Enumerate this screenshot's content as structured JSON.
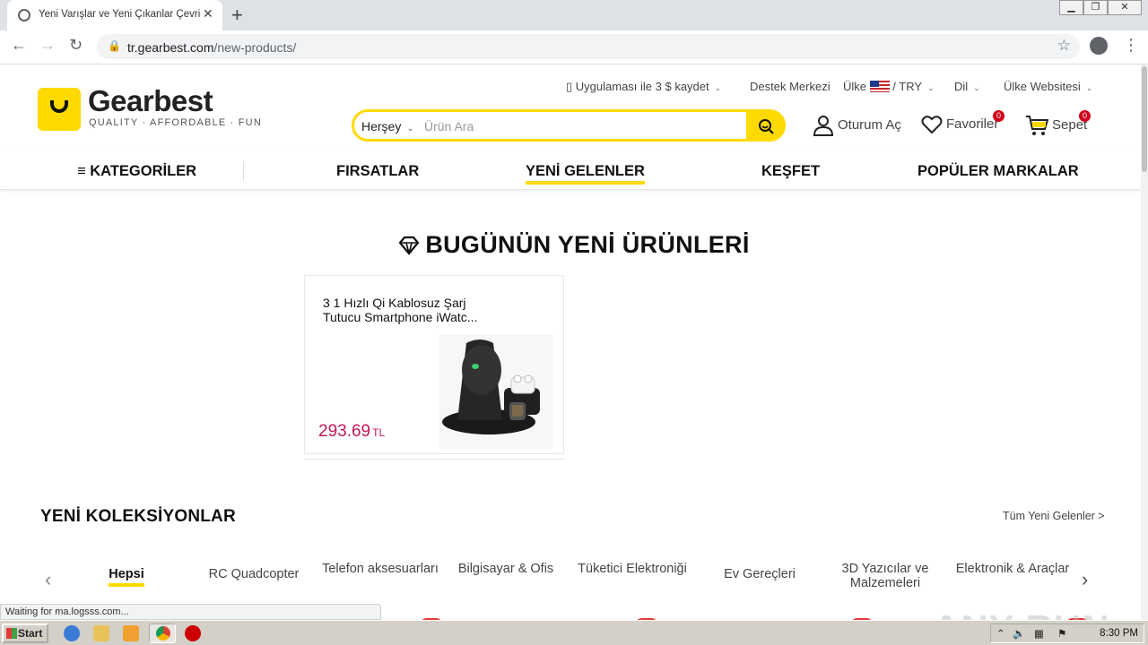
{
  "browser": {
    "tab_title": "Yeni Varışlar ve Yeni Çıkanlar Çevrimiçi",
    "url_host": "tr.gearbest.com",
    "url_path": "/new-products/",
    "status_text": "Waiting for ma.logsss.com..."
  },
  "header": {
    "top_links": {
      "app": "Uygulaması ile 3 $ kaydet",
      "support": "Destek Merkezi",
      "country": "Ülke",
      "currency": "/ TRY",
      "language": "Dil",
      "country_site": "Ülke Websitesi"
    },
    "logo": {
      "name": "Gearbest",
      "tagline": "QUALITY · AFFORDABLE · FUN"
    },
    "search": {
      "category": "Herşey",
      "placeholder": "Ürün Ara"
    },
    "actions": {
      "login": "Oturum Aç",
      "favorites": "Favoriler",
      "favorites_count": "0",
      "cart": "Sepet",
      "cart_count": "0"
    }
  },
  "nav": {
    "categories": "KATEGORİLER",
    "deals": "FIRSATLAR",
    "new_arrivals": "YENİ GELENLER",
    "explore": "KEŞFET",
    "brands": "POPÜLER MARKALAR"
  },
  "today": {
    "title": "BUGÜNÜN YENİ ÜRÜNLERİ",
    "product": {
      "name": "3 1 Hızlı Qi Kablosuz Şarj Tutucu Smartphone iWatc...",
      "price": "293.69",
      "currency": "TL"
    }
  },
  "collections": {
    "title": "YENİ KOLEKSİYONLAR",
    "all_link": "Tüm Yeni Gelenler >",
    "tabs": [
      "Hepsi",
      "RC Quadcopter",
      "Telefon aksesuarları",
      "Bilgisayar & Ofis",
      "Tüketici Elektroniği",
      "Ev Gereçleri",
      "3D Yazıcılar ve Malzemeleri",
      "Elektronik & Araçlar"
    ]
  },
  "watermark": "ANY RUN",
  "taskbar": {
    "start": "Start",
    "clock": "8:30 PM"
  },
  "colors": {
    "brand_yellow": "#ffda00",
    "price": "#c2185b",
    "badge": "#d0021b"
  }
}
